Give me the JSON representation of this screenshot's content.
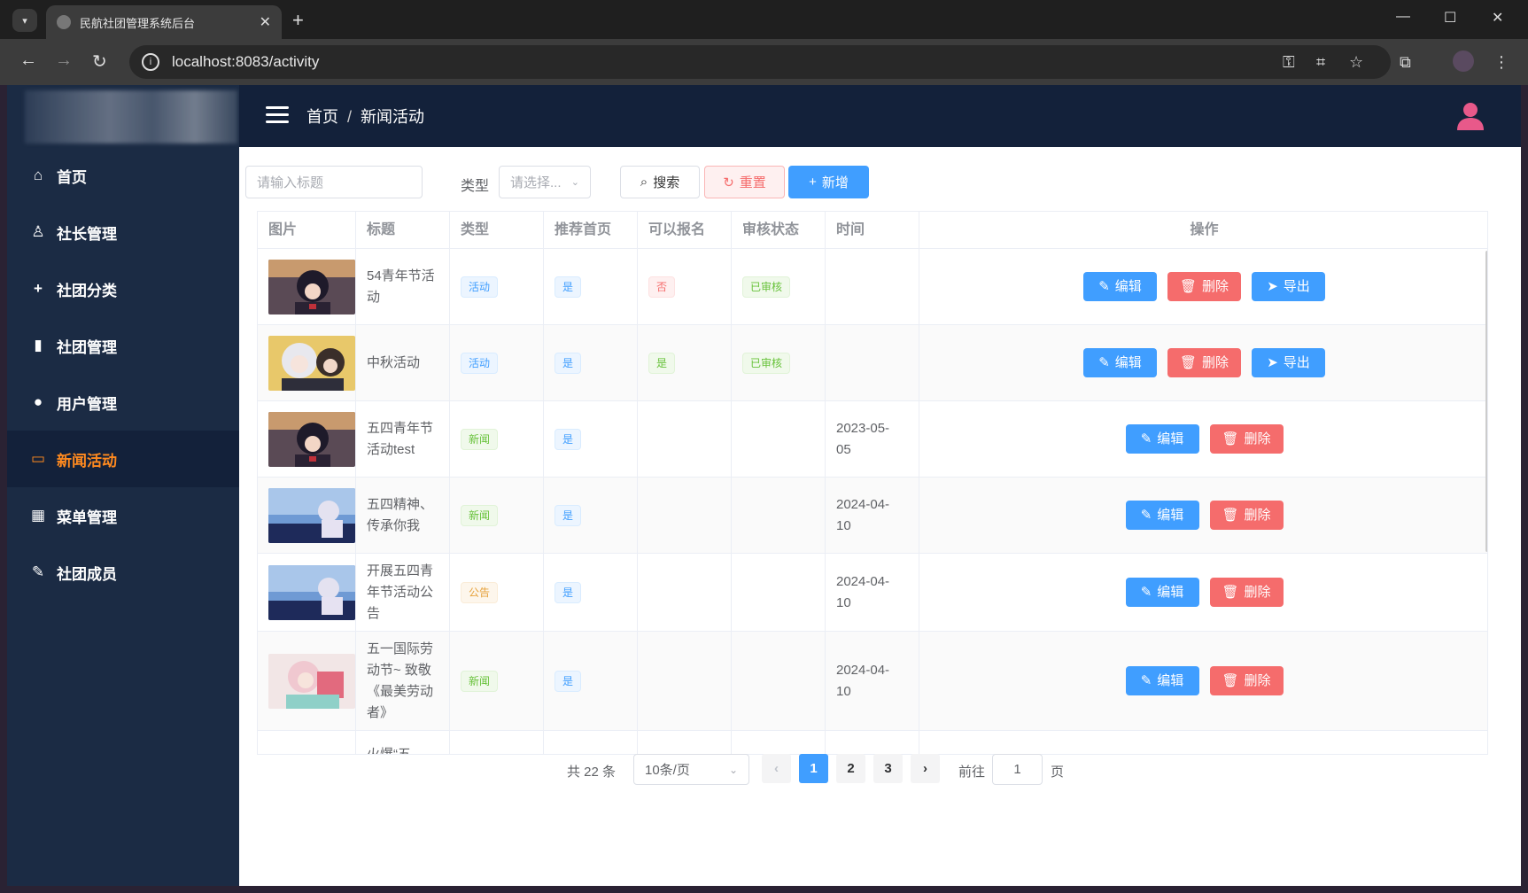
{
  "browser": {
    "tab_title": "民航社团管理系统后台",
    "url": "localhost:8083/activity"
  },
  "header": {
    "breadcrumb_home": "首页",
    "breadcrumb_sep": "/",
    "breadcrumb_current": "新闻活动"
  },
  "sidebar": {
    "items": [
      {
        "label": "首页",
        "icon": "home-icon"
      },
      {
        "label": "社长管理",
        "icon": "user-outline-icon"
      },
      {
        "label": "社团分类",
        "icon": "plus-icon"
      },
      {
        "label": "社团管理",
        "icon": "bar-chart-icon"
      },
      {
        "label": "用户管理",
        "icon": "user-icon"
      },
      {
        "label": "新闻活动",
        "icon": "card-icon"
      },
      {
        "label": "菜单管理",
        "icon": "grid-icon"
      },
      {
        "label": "社团成员",
        "icon": "edit-icon"
      }
    ],
    "active_index": 5
  },
  "filters": {
    "title_placeholder": "请输入标题",
    "type_label": "类型",
    "type_placeholder": "请选择...",
    "search_label": "搜索",
    "reset_label": "重置",
    "add_label": "新增"
  },
  "table": {
    "headers": [
      "图片",
      "标题",
      "类型",
      "推荐首页",
      "可以报名",
      "审核状态",
      "时间",
      "操作"
    ],
    "rows": [
      {
        "title_l1": "54青年节活",
        "title_l2": "动",
        "title_l3": "",
        "title_l4": "",
        "type": "活动",
        "type_color": "blue",
        "recommend": "是",
        "signup": "否",
        "signup_color": "red",
        "status": "已审核",
        "time_l1": "",
        "time_l2": "",
        "image": "anime-girl-dark-hair"
      },
      {
        "title_l1": "中秋活动",
        "title_l2": "",
        "title_l3": "",
        "title_l4": "",
        "type": "活动",
        "type_color": "blue",
        "recommend": "是",
        "signup": "是",
        "signup_color": "green",
        "status": "已审核",
        "time_l1": "",
        "time_l2": "",
        "image": "anime-girls-white-hair"
      },
      {
        "title_l1": "五四青年节",
        "title_l2": "活动test",
        "title_l3": "",
        "title_l4": "",
        "type": "新闻",
        "type_color": "green",
        "recommend": "是",
        "signup": "",
        "status": "",
        "time_l1": "2023-05-",
        "time_l2": "05",
        "image": "anime-girl-dark-hair"
      },
      {
        "title_l1": "五四精神、",
        "title_l2": "传承你我",
        "title_l3": "",
        "title_l4": "",
        "type": "新闻",
        "type_color": "green",
        "recommend": "是",
        "signup": "",
        "status": "",
        "time_l1": "2024-04-",
        "time_l2": "10",
        "image": "anime-girl-sky"
      },
      {
        "title_l1": "开展五四青",
        "title_l2": "年节活动公",
        "title_l3": "告",
        "title_l4": "",
        "type": "公告",
        "type_color": "orange",
        "recommend": "是",
        "signup": "",
        "status": "",
        "time_l1": "2024-04-",
        "time_l2": "10",
        "image": "anime-girl-sky"
      },
      {
        "title_l1": "五一国际劳",
        "title_l2": "动节~ 致敬",
        "title_l3": "《最美劳动",
        "title_l4": "者》",
        "type": "新闻",
        "type_color": "green",
        "recommend": "是",
        "signup": "",
        "status": "",
        "time_l1": "2024-04-",
        "time_l2": "10",
        "image": "anime-girl-pink"
      },
      {
        "title_l1": "火爆“五",
        "title_l2": "",
        "title_l3": "",
        "title_l4": "",
        "type": "",
        "recommend": "",
        "signup": "",
        "status": "",
        "time_l1": "",
        "time_l2": "",
        "image": "anime-partial"
      }
    ],
    "ops": {
      "edit": "编辑",
      "delete": "删除",
      "export": "导出"
    }
  },
  "pagination": {
    "total": "共 22 条",
    "page_size": "10条/页",
    "pages": [
      "1",
      "2",
      "3"
    ],
    "current": "1",
    "goto_label": "前往",
    "goto_value": "1",
    "page_suffix": "页"
  }
}
